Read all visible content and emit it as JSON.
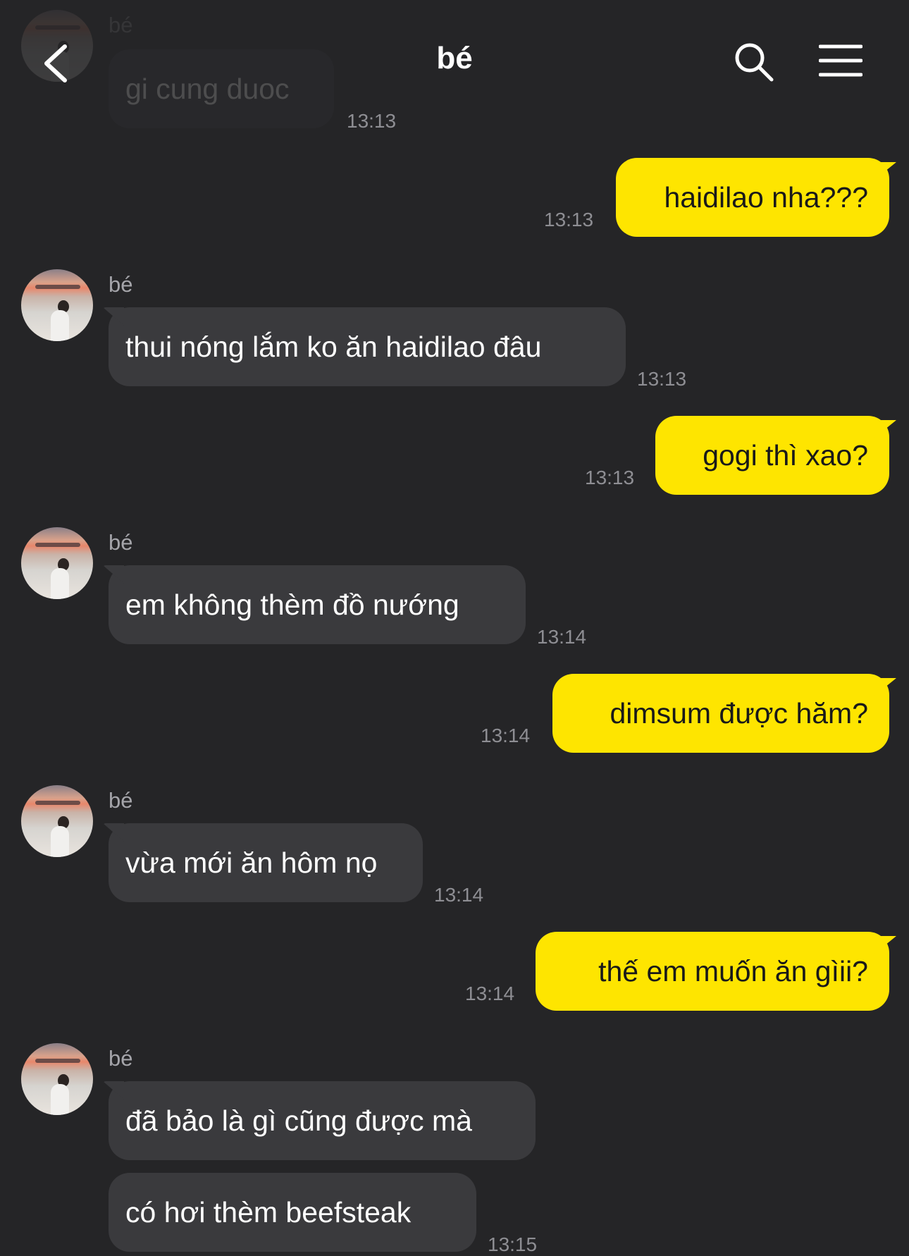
{
  "header": {
    "title": "bé",
    "back_icon": "chevron-left-icon",
    "search_icon": "search-icon",
    "menu_icon": "hamburger-menu-icon"
  },
  "top_partial": {
    "sender": "bé",
    "text": "gi cung duoc",
    "time": "13:13"
  },
  "messages": [
    {
      "direction": "out",
      "text": "haidilao nha???",
      "time": "13:13"
    },
    {
      "direction": "in",
      "sender": "bé",
      "text": "thui nóng lắm ko ăn haidilao đâu",
      "time": "13:13"
    },
    {
      "direction": "out",
      "text": "gogi thì xao?",
      "time": "13:13"
    },
    {
      "direction": "in",
      "sender": "bé",
      "text": "em không thèm đồ nướng",
      "time": "13:14"
    },
    {
      "direction": "out",
      "text": "dimsum được hăm?",
      "time": "13:14"
    },
    {
      "direction": "in",
      "sender": "bé",
      "text": "vừa mới ăn hôm nọ",
      "time": "13:14"
    },
    {
      "direction": "out",
      "text": "thế em muốn ăn gìii?",
      "time": "13:14"
    },
    {
      "direction": "in",
      "sender": "bé",
      "texts": [
        "đã bảo là gì cũng được mà",
        "có hơi thèm beefsteak"
      ],
      "time": "13:15"
    }
  ],
  "colors": {
    "background": "#252527",
    "incoming_bubble": "#3a3a3d",
    "outgoing_bubble": "#fee500",
    "timestamp": "#8e8e93"
  }
}
